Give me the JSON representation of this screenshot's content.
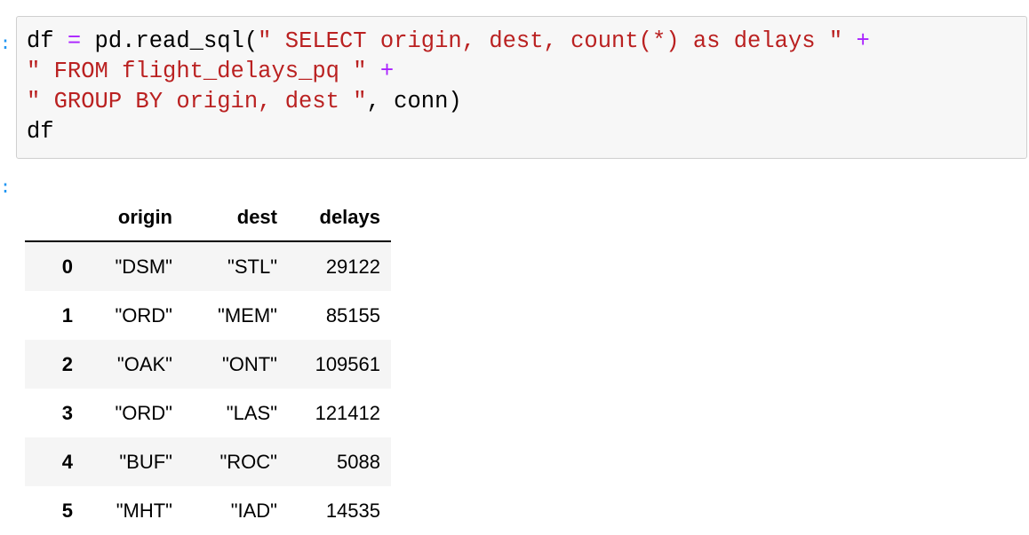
{
  "code": {
    "line1": {
      "a": "df ",
      "eq": "=",
      "b": " pd.read_sql(",
      "str": "\" SELECT origin, dest, count(*) as delays \"",
      "c": " ",
      "plus": "+"
    },
    "line2": {
      "str": "\" FROM flight_delays_pq \"",
      "c": " ",
      "plus": "+"
    },
    "line3": {
      "str": "\" GROUP BY origin, dest \"",
      "rest": ", conn)"
    },
    "line4": "df"
  },
  "table": {
    "headers": [
      "",
      "origin",
      "dest",
      "delays"
    ],
    "rows": [
      [
        "0",
        "\"DSM\"",
        "\"STL\"",
        "29122"
      ],
      [
        "1",
        "\"ORD\"",
        "\"MEM\"",
        "85155"
      ],
      [
        "2",
        "\"OAK\"",
        "\"ONT\"",
        "109561"
      ],
      [
        "3",
        "\"ORD\"",
        "\"LAS\"",
        "121412"
      ],
      [
        "4",
        "\"BUF\"",
        "\"ROC\"",
        "5088"
      ],
      [
        "5",
        "\"MHT\"",
        "\"IAD\"",
        "14535"
      ]
    ]
  },
  "colors": {
    "string": "#ba2121",
    "operator": "#aa22ff",
    "prompt": "#2196f3"
  }
}
